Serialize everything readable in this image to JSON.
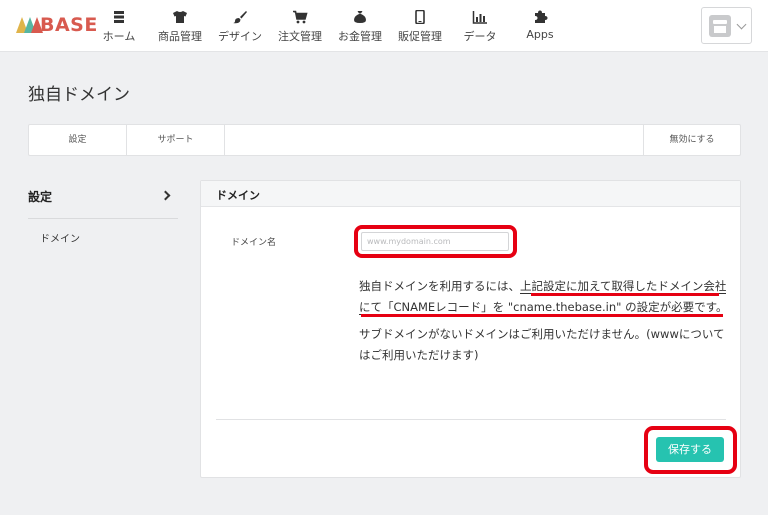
{
  "header": {
    "logo_text": "BASE",
    "nav": [
      {
        "label": "ホーム",
        "icon": "home-list-icon"
      },
      {
        "label": "商品管理",
        "icon": "tshirt-icon"
      },
      {
        "label": "デザイン",
        "icon": "brush-icon"
      },
      {
        "label": "注文管理",
        "icon": "cart-icon"
      },
      {
        "label": "お金管理",
        "icon": "money-bag-icon"
      },
      {
        "label": "販促管理",
        "icon": "phone-icon"
      },
      {
        "label": "データ",
        "icon": "bar-chart-icon"
      },
      {
        "label": "Apps",
        "icon": "puzzle-icon"
      }
    ],
    "store_icon": "store-icon"
  },
  "page": {
    "title": "独自ドメイン",
    "tabs": [
      "設定",
      "サポート"
    ],
    "disable_tab": "無効にする"
  },
  "sidebar": {
    "heading": "設定",
    "items": [
      "ドメイン"
    ]
  },
  "panel": {
    "title": "ドメイン",
    "field_label": "ドメイン名",
    "input_value": "",
    "input_placeholder": "www.mydomain.com",
    "note_intro": "独自ドメインを利用するには、",
    "note_underlined": "上記設定に加えて取得したドメイン会社にて「CNAMEレコード」を \"cname.thebase.in\" の設定が必要",
    "note_end": "です。",
    "note2": "サブドメインがないドメインはご利用いただけません。(wwwについてはご利用いただけます)",
    "save_label": "保存する"
  },
  "colors": {
    "accent": "#26c3b0",
    "highlight": "#e60012",
    "logo": "#d85a4f"
  }
}
